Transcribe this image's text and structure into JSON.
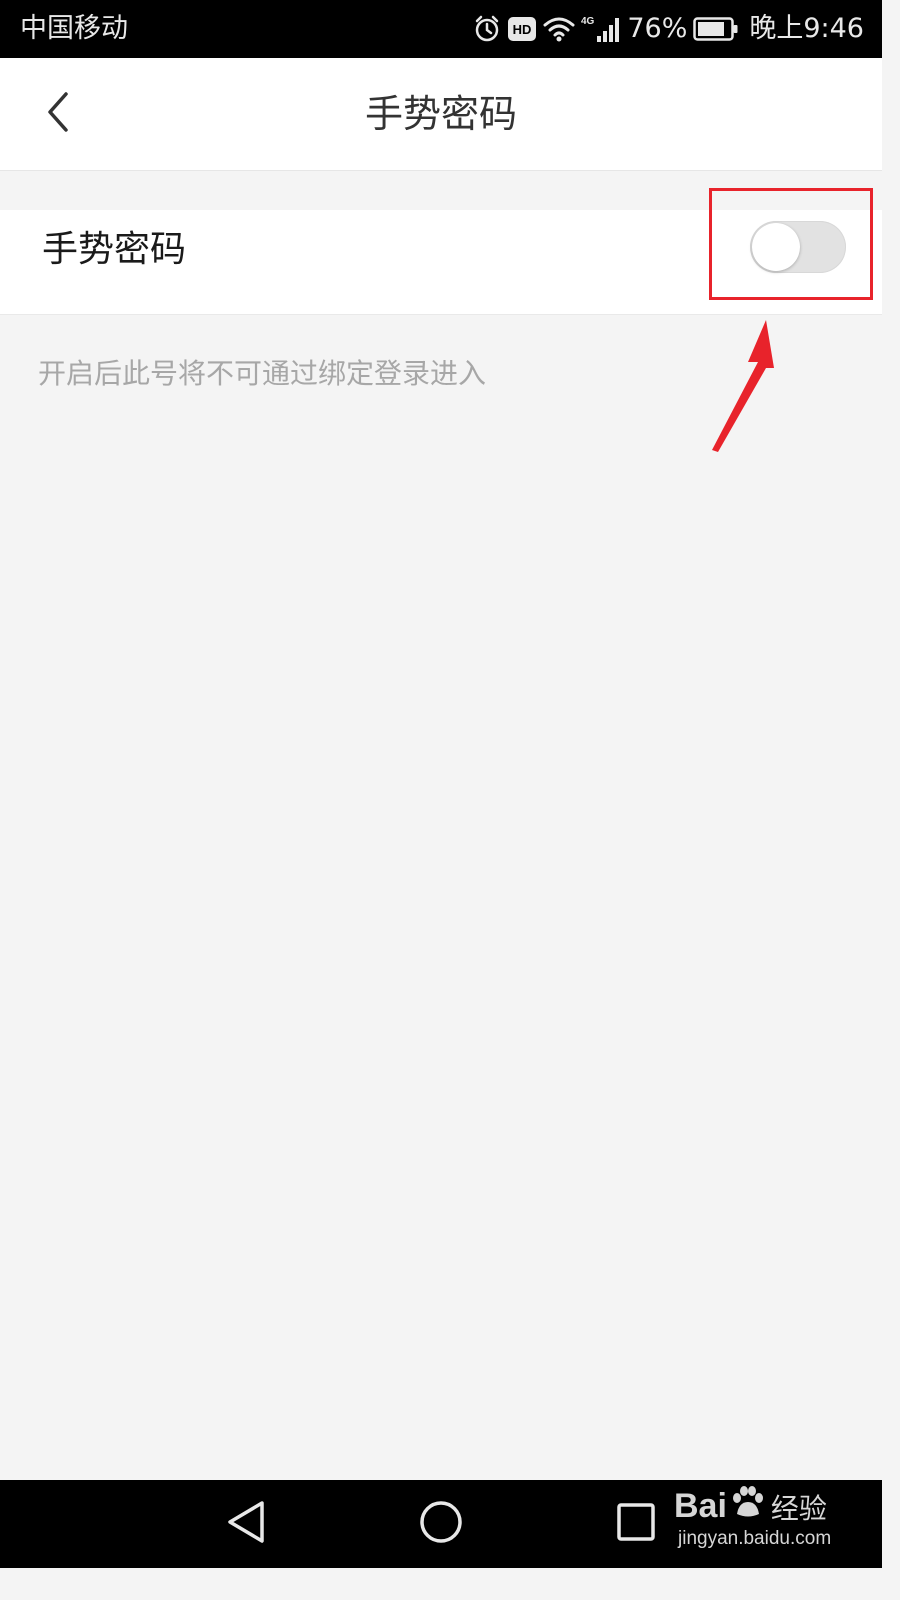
{
  "status_bar": {
    "carrier": "中国移动",
    "network": "4G",
    "battery_percent": "76%",
    "time": "晚上9:46",
    "icons": [
      "alarm-icon",
      "hd-icon",
      "wifi-icon",
      "cellular-signal-icon",
      "battery-icon"
    ]
  },
  "header": {
    "back_icon": "chevron-left-icon",
    "title": "手势密码"
  },
  "settings": {
    "gesture_password": {
      "label": "手势密码",
      "enabled": false
    },
    "hint": "开启后此号将不可通过绑定登录进入"
  },
  "annotation": {
    "color": "#e8232b",
    "shapes": [
      "highlight-box",
      "arrow"
    ]
  },
  "nav_bar": {
    "icons": [
      "nav-back-icon",
      "nav-home-icon",
      "nav-recent-icon"
    ]
  },
  "watermark": {
    "brand_left": "Bai",
    "brand_right": "经验",
    "url": "jingyan.baidu.com"
  },
  "colors": {
    "background": "#f4f4f4",
    "toggle_off": "#e2e2e2",
    "hint_text": "#a7a7a7"
  }
}
